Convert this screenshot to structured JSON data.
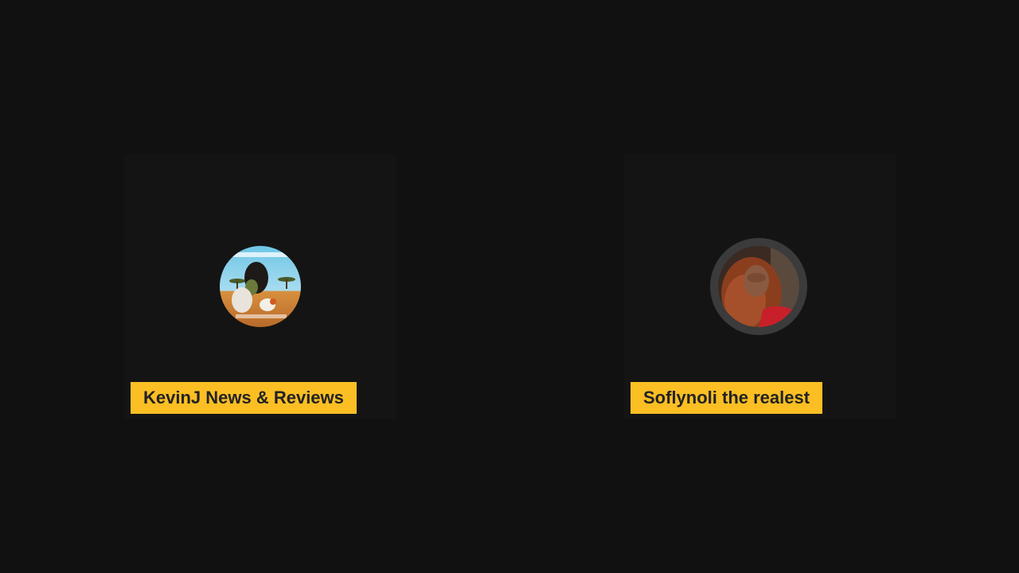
{
  "participants": [
    {
      "name": "KevinJ News & Reviews",
      "avatar_icon": "lion-savanna-avatar"
    },
    {
      "name": "Soflynoli the realest",
      "avatar_icon": "woman-portrait-avatar"
    }
  ],
  "colors": {
    "background": "#111111",
    "tile": "#141414",
    "name_tag": "#fbbf24",
    "name_text": "#222222",
    "active_ring": "#3b3b3b"
  }
}
